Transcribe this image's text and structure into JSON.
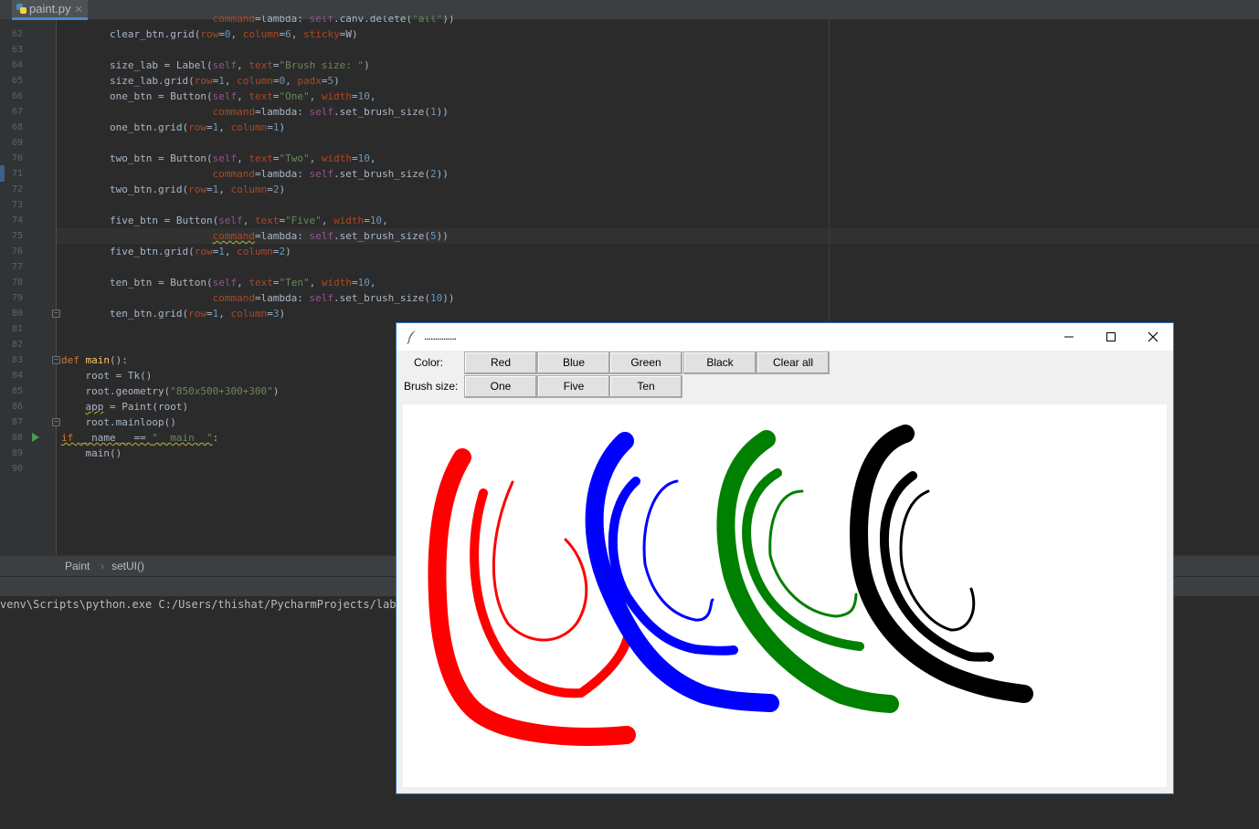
{
  "ide": {
    "tab": {
      "label": "paint.py",
      "close": "✕"
    },
    "line_numbers": [
      "62",
      "63",
      "64",
      "65",
      "66",
      "67",
      "68",
      "69",
      "70",
      "71",
      "72",
      "73",
      "74",
      "75",
      "76",
      "77",
      "78",
      "79",
      "80",
      "81",
      "82",
      "83",
      "84",
      "85",
      "86",
      "87",
      "88",
      "89",
      "90"
    ],
    "breadcrumb": {
      "class": "Paint",
      "sep": "›",
      "method": "setUI()"
    },
    "console_line": "venv\\Scripts\\python.exe C:/Users/thishat/PycharmProjects/lab3/p"
  },
  "tk_window": {
    "title": "...............",
    "color_label": "Color:",
    "brush_label": "Brush size:",
    "color_buttons": [
      "Red",
      "Blue",
      "Green",
      "Black",
      "Clear all"
    ],
    "size_buttons": [
      "One",
      "Five",
      "Ten"
    ]
  },
  "colors": {
    "stroke_red": "#ff0000",
    "stroke_blue": "#0000ff",
    "stroke_green": "#008000",
    "stroke_black": "#000000",
    "window_border": "#2f78d2"
  }
}
